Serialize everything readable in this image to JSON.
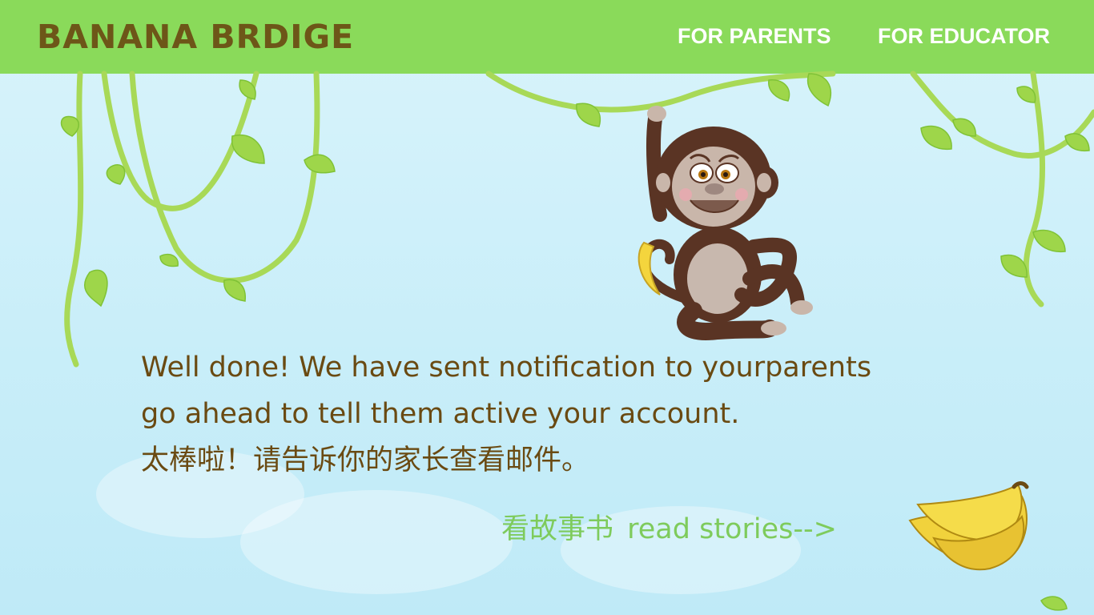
{
  "header": {
    "logo": "BANANA BRDIGE",
    "nav": [
      {
        "label": "FOR PARENTS"
      },
      {
        "label": "FOR EDUCATOR"
      }
    ]
  },
  "message": {
    "line1": "Well done! We have sent notification to yourparents",
    "line2": "go ahead to tell them active your account.",
    "line3": "太棒啦！请告诉你的家长查看邮件。"
  },
  "stories_link": {
    "label_cn": "看故事书",
    "label_en": "read stories-->"
  },
  "images": {
    "mascot": "monkey-mascot",
    "banana_icon": "banana-bunch-icon",
    "decoration": "jungle-vines"
  },
  "colors": {
    "header_bg": "#8ada5a",
    "logo": "#6d5618",
    "message_text": "#6a4a12",
    "link": "#7ecb5c",
    "sky": "#cdeffa"
  }
}
